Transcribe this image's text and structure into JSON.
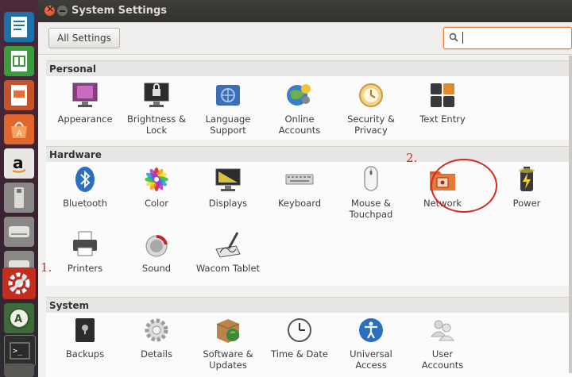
{
  "window": {
    "title": "System Settings"
  },
  "toolbar": {
    "all_settings_label": "All Settings",
    "search_value": "",
    "search_placeholder": ""
  },
  "sections": {
    "personal": {
      "title": "Personal",
      "items": [
        {
          "label": "Appearance"
        },
        {
          "label": "Brightness &\nLock"
        },
        {
          "label": "Language\nSupport"
        },
        {
          "label": "Online\nAccounts"
        },
        {
          "label": "Security &\nPrivacy"
        },
        {
          "label": "Text Entry"
        }
      ]
    },
    "hardware": {
      "title": "Hardware",
      "items": [
        {
          "label": "Bluetooth"
        },
        {
          "label": "Color"
        },
        {
          "label": "Displays"
        },
        {
          "label": "Keyboard"
        },
        {
          "label": "Mouse &\nTouchpad"
        },
        {
          "label": "Network"
        },
        {
          "label": "Power"
        },
        {
          "label": "Printers"
        },
        {
          "label": "Sound"
        },
        {
          "label": "Wacom Tablet"
        }
      ]
    },
    "system": {
      "title": "System",
      "items": [
        {
          "label": "Backups"
        },
        {
          "label": "Details"
        },
        {
          "label": "Software &\nUpdates"
        },
        {
          "label": "Time & Date"
        },
        {
          "label": "Universal\nAccess"
        },
        {
          "label": "User\nAccounts"
        }
      ]
    }
  },
  "annotations": {
    "step1": "1.",
    "step2": "2."
  },
  "launcher": [
    "writer-icon",
    "calc-icon",
    "impress-icon",
    "software-center-icon",
    "amazon-icon",
    "usb-drive-icon",
    "drive-icon",
    "drive-icon",
    "system-settings-icon",
    "updater-icon",
    "terminal-icon",
    "workspace-icon"
  ],
  "colors": {
    "accent": "#e07a3c",
    "annotation": "#d6281f"
  }
}
